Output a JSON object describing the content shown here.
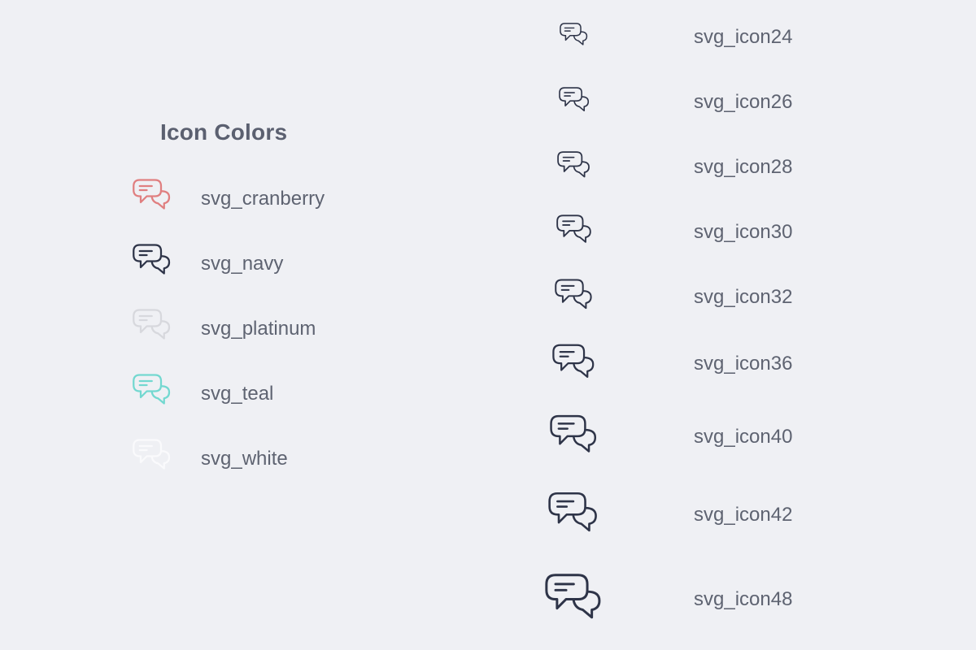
{
  "heading": "Icon Colors",
  "colors": {
    "cranberry": "#e07f80",
    "navy": "#2e3448",
    "platinum": "#d7d8dd",
    "teal": "#73d8d0",
    "white": "#fafafc"
  },
  "icon": "chat-bubbles-icon",
  "color_items": [
    {
      "label": "svg_cranberry",
      "color": "#e07f80"
    },
    {
      "label": "svg_navy",
      "color": "#2e3448"
    },
    {
      "label": "svg_platinum",
      "color": "#d7d8dd"
    },
    {
      "label": "svg_teal",
      "color": "#73d8d0"
    },
    {
      "label": "svg_white",
      "color": "#fafafc"
    }
  ],
  "size_items": [
    {
      "label": "svg_icon24",
      "size": 24
    },
    {
      "label": "svg_icon26",
      "size": 26
    },
    {
      "label": "svg_icon28",
      "size": 28
    },
    {
      "label": "svg_icon30",
      "size": 30
    },
    {
      "label": "svg_icon32",
      "size": 32
    },
    {
      "label": "svg_icon36",
      "size": 36
    },
    {
      "label": "svg_icon40",
      "size": 40
    },
    {
      "label": "svg_icon42",
      "size": 42
    },
    {
      "label": "svg_icon48",
      "size": 48
    }
  ]
}
